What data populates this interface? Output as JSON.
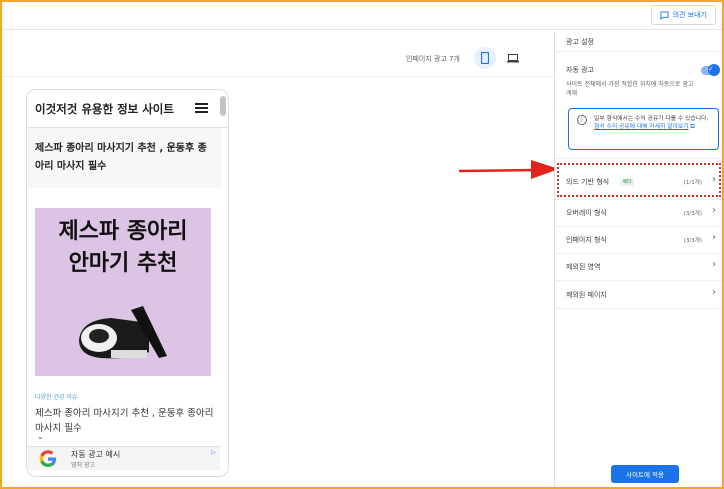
{
  "header": {
    "feedback_label": "의견 보내기"
  },
  "preview": {
    "ad_count": "인페이지 광고 7개",
    "device_mobile_icon": "mobile-phone-icon",
    "device_desktop_icon": "laptop-icon"
  },
  "phone": {
    "site_title": "이것저것 유용한 정보 사이트",
    "post_heading": "제스파 종아리 마사지기 추천 , 운동후 종아리 마사지 필수",
    "image_text_line1": "제스파 종아리",
    "image_text_line2": "안마기 추천",
    "category": "다양한 건강 이슈",
    "post_title": "제스파 종아리 마사지기 추천 , 운동후 종아리 마사지 필수",
    "ad_title": "자동 광고 예시",
    "ad_sub": "영처 광고",
    "ad_info": "▷"
  },
  "panel": {
    "title": "광고 설정",
    "auto_ads_label": "자동 광고",
    "auto_ads_enabled": true,
    "auto_ads_desc": "사이트 전체에서 가장 적합한 위치에 자동으로 광고 게재",
    "info_text": "일부 형식에서는 수익 공유가 다를 수 있습니다.",
    "info_link": "형식 수익 공유에 대해 자세히 알아보기",
    "formats": [
      {
        "label": "의드 기반 형식",
        "badge": "베타",
        "count": "(1/1개)"
      },
      {
        "label": "오버레이 형식",
        "count": "(3/3개)"
      },
      {
        "label": "인페이지 형식",
        "count": "(3/3개)"
      },
      {
        "label": "제외된 영역",
        "count": ""
      },
      {
        "label": "제외된 페이지",
        "count": ""
      }
    ],
    "apply_label": "사이트에 적용"
  }
}
